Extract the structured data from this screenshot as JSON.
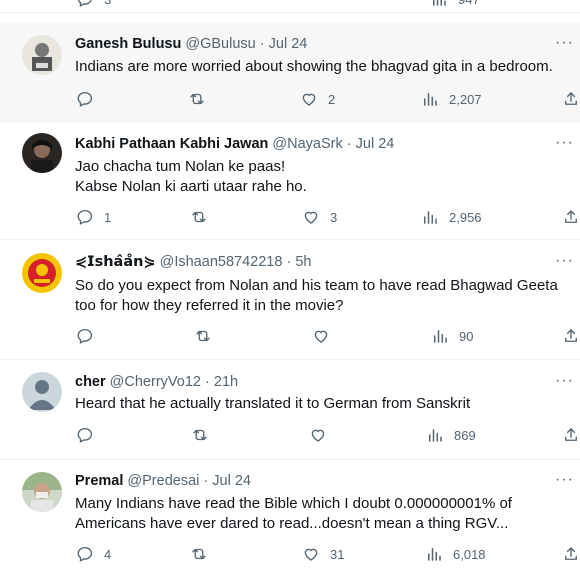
{
  "colors": {
    "muted": "#536471",
    "text": "#0f1419",
    "highlight_bg": "#f7f7f7"
  },
  "top_strip": {
    "replies": "3",
    "views": "947"
  },
  "tweets": [
    {
      "name": "Ganesh Bulusu",
      "handle": "@GBulusu",
      "time": "Jul 24",
      "lines": [
        "Indians are more worried about showing the bhagvad gita in a bedroom."
      ],
      "replies": "",
      "likes": "2",
      "views": "2,207",
      "avatar_icon": "person-sketch-avatar"
    },
    {
      "name": "Kabhi Pathaan Kabhi Jawan",
      "handle": "@NayaSrk",
      "time": "Jul 24",
      "lines": [
        "Jao chacha tum Nolan ke paas!",
        "Kabse Nolan ki aarti utaar rahe ho."
      ],
      "replies": "1",
      "likes": "3",
      "views": "2,956",
      "avatar_icon": "portrait-avatar"
    },
    {
      "name": "⋞𝗜𝘀𝗵𝗮̂𝗮̊𝗻⋟",
      "handle": "@Ishaan58742218",
      "time": "5h",
      "lines": [
        "So do you expect from Nolan and his team to have read Bhagwad Geeta",
        "too for how they referred it in the movie?"
      ],
      "replies": "",
      "likes": "",
      "views": "90",
      "avatar_icon": "logo-avatar"
    },
    {
      "name": "cher",
      "handle": "@CherryVo12",
      "time": "21h",
      "lines": [
        "Heard that he actually translated it to German from Sanskrit"
      ],
      "replies": "",
      "likes": "",
      "views": "869",
      "avatar_icon": "default-avatar"
    },
    {
      "name": "Premal",
      "handle": "@Predesai",
      "time": "Jul 24",
      "lines": [
        "Many Indians have read the Bible which I doubt 0.000000001% of",
        "Americans have ever dared to read...doesn't mean a thing RGV..."
      ],
      "replies": "4",
      "likes": "31",
      "views": "6,018",
      "avatar_icon": "photo-avatar"
    }
  ]
}
